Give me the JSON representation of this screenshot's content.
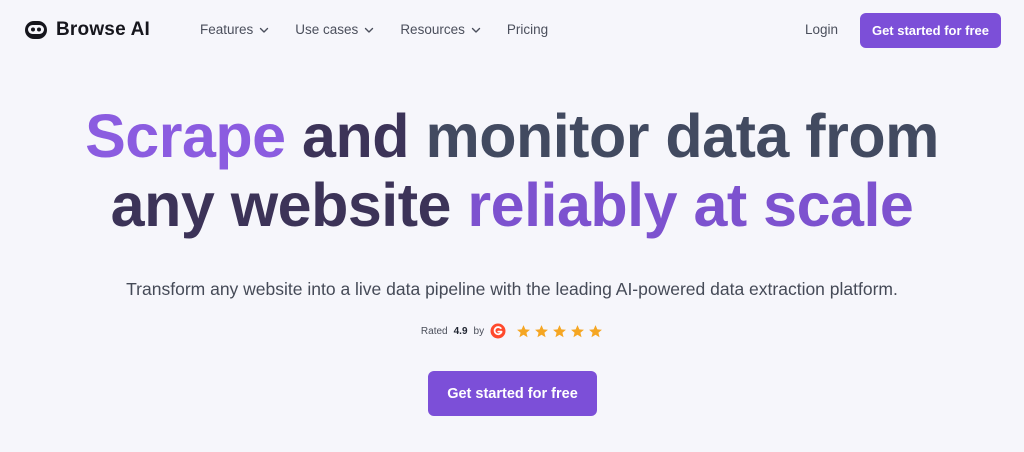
{
  "nav": {
    "brand_name": "Browse AI",
    "items": [
      {
        "label": "Features",
        "has_dropdown": true
      },
      {
        "label": "Use cases",
        "has_dropdown": true
      },
      {
        "label": "Resources",
        "has_dropdown": true
      },
      {
        "label": "Pricing",
        "has_dropdown": false
      }
    ],
    "login_label": "Login",
    "cta_label": "Get started for free"
  },
  "hero": {
    "title_segments": [
      {
        "text": "Scrape ",
        "color": "#8b5ce0"
      },
      {
        "text": "and ",
        "color": "#3c3358"
      },
      {
        "text": "monitor data from",
        "color": "#424a60"
      },
      {
        "text": "any website ",
        "color": "#3c3358"
      },
      {
        "text": "reliably at scale",
        "color": "#7d52cf"
      }
    ],
    "subtitle": "Transform any website into a live data pipeline with the leading AI-powered data extraction platform.",
    "rating": {
      "prefix": "Rated",
      "value": "4.9",
      "suffix": "by",
      "source_icon": "g2-logo-icon",
      "stars": 5
    },
    "cta_label": "Get started for free"
  },
  "colors": {
    "accent": "#7c4fd8",
    "background": "#f6f6fb",
    "star": "#f5a623",
    "g2": "#ff492c"
  }
}
